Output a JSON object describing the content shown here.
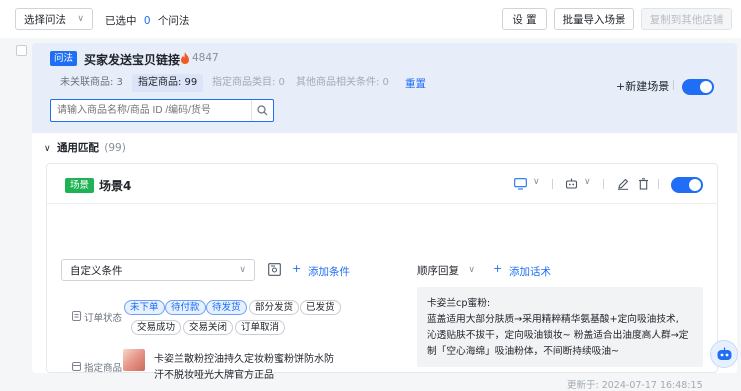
{
  "toolbar": {
    "method_select": "选择问法",
    "selected_prefix": "已选中",
    "selected_count": "0",
    "selected_suffix": "个问法",
    "settings_label": "设 置",
    "bulk_import_label": "批量导入场景",
    "copy_to_shop_label": "复制到其他店铺"
  },
  "question": {
    "tag": "问法",
    "title": "买家发送宝贝链接",
    "heat": "4847",
    "filters": [
      {
        "label": "未关联商品: 3"
      },
      {
        "label": "指定商品: 99"
      },
      {
        "label": "指定商品类目: 0"
      },
      {
        "label": "其他商品相关条件: 0"
      }
    ],
    "reset_label": "重置",
    "search_placeholder": "请输入商品名称/商品 ID /编码/货号",
    "new_scene_label": "+新建场景"
  },
  "general_match": {
    "label": "通用匹配",
    "count": "(99)"
  },
  "scene": {
    "tag": "场景",
    "title": "场景4",
    "condition_select": "自定义条件",
    "add_condition_label": "添加条件",
    "reply_order_select": "顺序回复",
    "add_script_label": "添加话术",
    "order_status_label": "订单状态",
    "order_status_options": [
      {
        "label": "未下单",
        "on": true
      },
      {
        "label": "待付款",
        "on": true
      },
      {
        "label": "待发货",
        "on": true
      },
      {
        "label": "部分发货",
        "on": false
      },
      {
        "label": "已发货",
        "on": false
      },
      {
        "label": "交易成功",
        "on": false
      },
      {
        "label": "交易关闭",
        "on": false
      },
      {
        "label": "订单取消",
        "on": false
      }
    ],
    "product_label": "指定商品",
    "product_name_line1": "卡姿兰散粉控油持久定妆粉蜜粉饼防水防",
    "product_name_line2": "汗不脱妆哑光大牌官方正品",
    "reply_title": "卡姿兰cp蜜粉:",
    "reply_line1": "蓝盖适用大部分肤质→采用精粹精华氨基酸+定向吸油技术,",
    "reply_line2": "沁透贴肤不拔干，定向吸油锁妆~ 粉盖适合出油度高人群→定",
    "reply_line3": "制「空心海绵」吸油粉体，不间断持续吸油~",
    "updated_at": "更新于: 2024-07-17 16:48:15"
  },
  "colors": {
    "accent": "#1f6ef5",
    "scene_tag": "#1fb254",
    "heat": "#f15a24"
  }
}
